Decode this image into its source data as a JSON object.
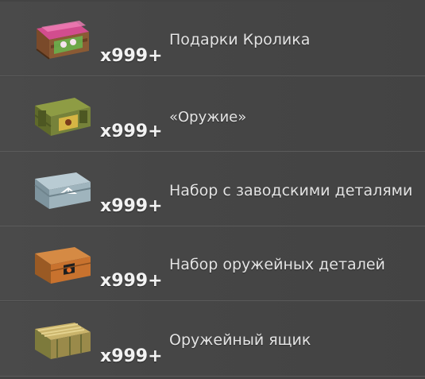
{
  "items": [
    {
      "name": "Подарки Кролика",
      "count": "x999+",
      "icon": "gift-crate-icon",
      "color": "#e05a9a"
    },
    {
      "name": "«Оружие»",
      "count": "x999+",
      "icon": "weapon-crate-icon",
      "color": "#7a8a3a"
    },
    {
      "name": "Набор с заводскими деталями",
      "count": "x999+",
      "icon": "metal-case-icon",
      "color": "#9fb4bd"
    },
    {
      "name": "Набор оружейных деталей",
      "count": "x999+",
      "icon": "wooden-parts-box-icon",
      "color": "#c8722e"
    },
    {
      "name": "Оружейный ящик",
      "count": "x999+",
      "icon": "weapon-box-icon",
      "color": "#9a8a4a"
    }
  ]
}
